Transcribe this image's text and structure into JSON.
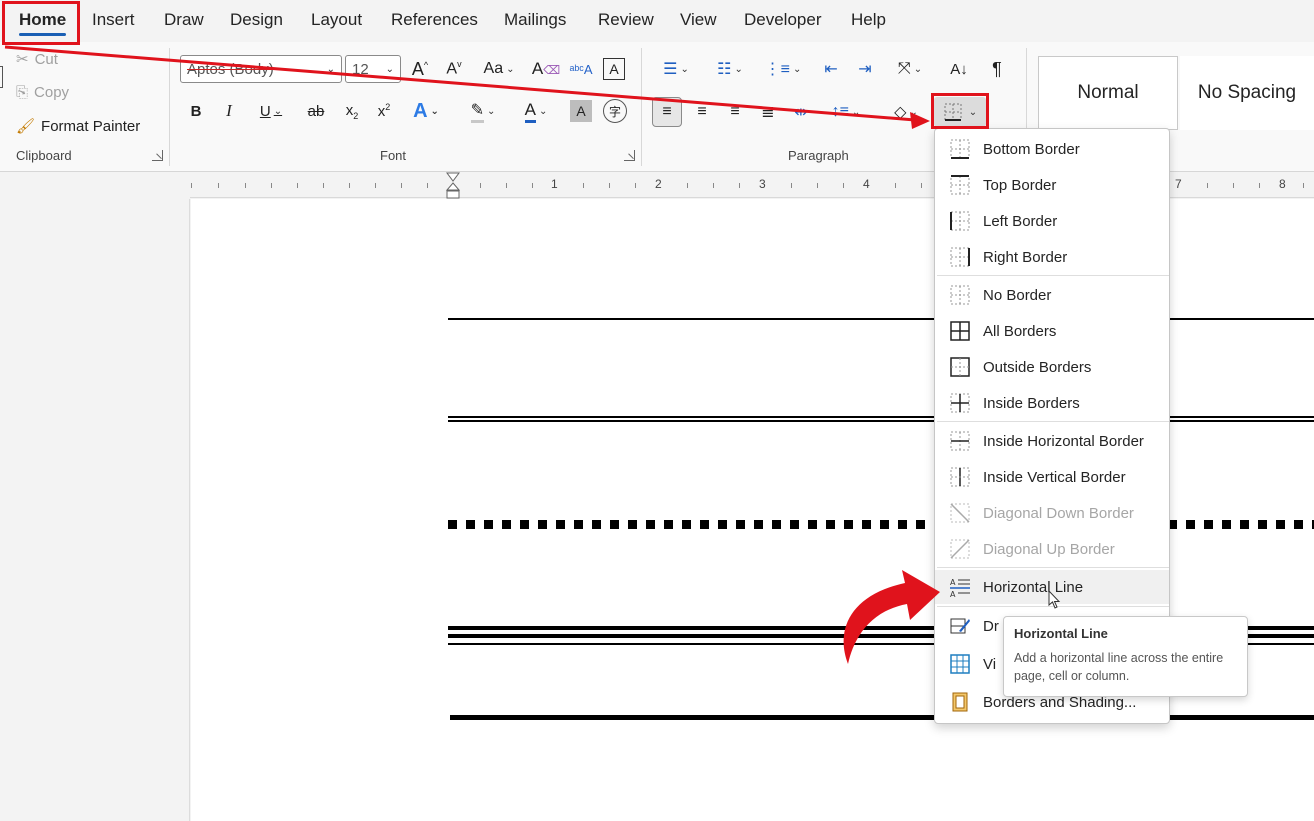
{
  "tabs": [
    "Home",
    "Insert",
    "Draw",
    "Design",
    "Layout",
    "References",
    "Mailings",
    "Review",
    "View",
    "Developer",
    "Help"
  ],
  "clipboard": {
    "cut": "Cut",
    "copy": "Copy",
    "format_painter": "Format Painter",
    "label": "Clipboard"
  },
  "font": {
    "name": "Aptos (Body)",
    "size": "12",
    "label": "Font",
    "case_label": "Aa"
  },
  "paragraph": {
    "label": "Paragraph"
  },
  "styles": {
    "normal": "Normal",
    "no_spacing": "No Spacing"
  },
  "ruler_numbers": [
    "1",
    "2",
    "3",
    "4",
    "7",
    "8"
  ],
  "borders_menu": {
    "items": [
      {
        "label": "Bottom Border",
        "icon": "bottom-border-icon"
      },
      {
        "label": "Top Border",
        "icon": "top-border-icon"
      },
      {
        "label": "Left Border",
        "icon": "left-border-icon"
      },
      {
        "label": "Right Border",
        "icon": "right-border-icon"
      },
      {
        "label": "No Border",
        "icon": "no-border-icon"
      },
      {
        "label": "All Borders",
        "icon": "all-borders-icon"
      },
      {
        "label": "Outside Borders",
        "icon": "outside-borders-icon"
      },
      {
        "label": "Inside Borders",
        "icon": "inside-borders-icon"
      },
      {
        "label": "Inside Horizontal Border",
        "icon": "inside-horizontal-border-icon"
      },
      {
        "label": "Inside Vertical Border",
        "icon": "inside-vertical-border-icon"
      },
      {
        "label": "Diagonal Down Border",
        "icon": "diagonal-down-border-icon",
        "disabled": true
      },
      {
        "label": "Diagonal Up Border",
        "icon": "diagonal-up-border-icon",
        "disabled": true
      },
      {
        "label": "Horizontal Line",
        "icon": "horizontal-line-icon",
        "highlighted": true
      },
      {
        "label": "Dr",
        "icon": "draw-table-icon"
      },
      {
        "label": "Vi",
        "icon": "view-gridlines-icon"
      },
      {
        "label": "Borders and Shading...",
        "icon": "borders-shading-icon"
      }
    ]
  },
  "tooltip": {
    "title": "Horizontal Line",
    "description": "Add a horizontal line across the entire page, cell or column."
  },
  "colors": {
    "annotation_red": "#e0131c",
    "accent_blue": "#1a5fb4"
  }
}
